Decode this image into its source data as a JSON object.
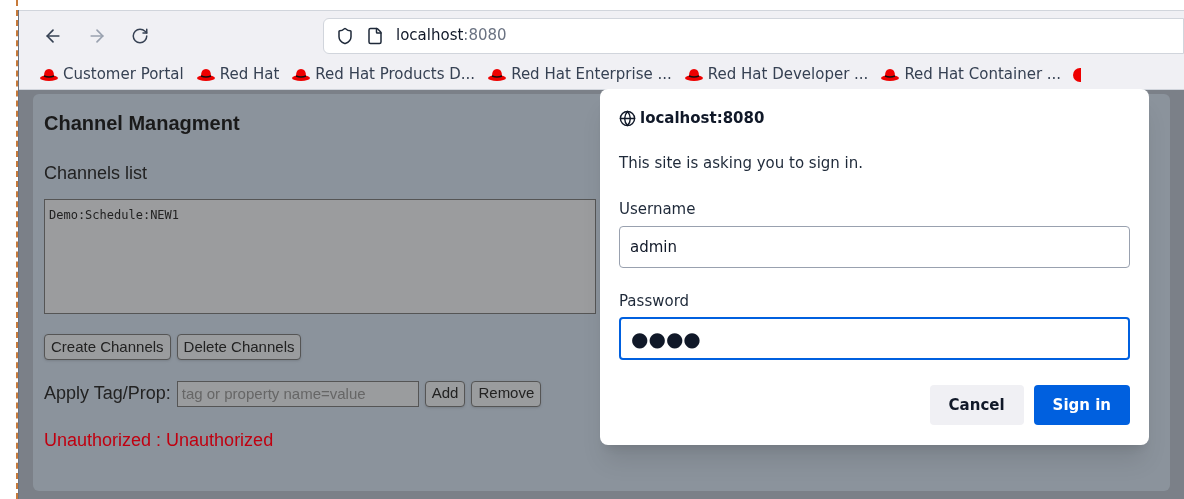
{
  "toolbar": {
    "url_host": "localhost",
    "url_port": ":8080",
    "forward_disabled": true
  },
  "bookmarks": [
    {
      "label": "Customer Portal"
    },
    {
      "label": "Red Hat"
    },
    {
      "label": "Red Hat Products D..."
    },
    {
      "label": "Red Hat Enterprise ..."
    },
    {
      "label": "Red Hat Developer ..."
    },
    {
      "label": "Red Hat Container ..."
    }
  ],
  "page": {
    "title": "Channel Managment",
    "list_label": "Channels list",
    "channels_text": "Demo:Schedule:NEW1",
    "buttons": [
      "Create Channels",
      "Delete Channels"
    ],
    "tag_label": "Apply Tag/Prop:",
    "tag_placeholder": "tag or property name=value",
    "tag_buttons": [
      "Add",
      "Remove"
    ],
    "error": "Unauthorized : Unauthorized"
  },
  "dialog": {
    "host": "localhost:8080",
    "message": "This site is asking you to sign in.",
    "username_label": "Username",
    "username": "admin",
    "password_label": "Password",
    "password": "●●●●",
    "password_focused": true,
    "cancel": "Cancel",
    "submit": "Sign in"
  }
}
